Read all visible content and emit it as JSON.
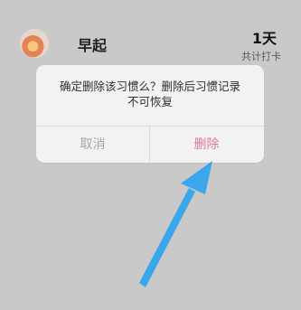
{
  "habit": {
    "name": "早起",
    "count": "1天",
    "count_label": "共计打卡"
  },
  "dialog": {
    "message_line1": "确定删除该习惯么？删除后习惯记录",
    "message_line2": "不可恢复",
    "cancel_label": "取消",
    "delete_label": "删除"
  },
  "colors": {
    "overlay_bg": "#c9c9c9",
    "dialog_bg": "#f2f2f2",
    "delete_color": "#e0759a",
    "cancel_color": "#a6a6a6",
    "arrow_color": "#3aa6ec"
  },
  "annotation": {
    "icon": "arrow-icon"
  }
}
